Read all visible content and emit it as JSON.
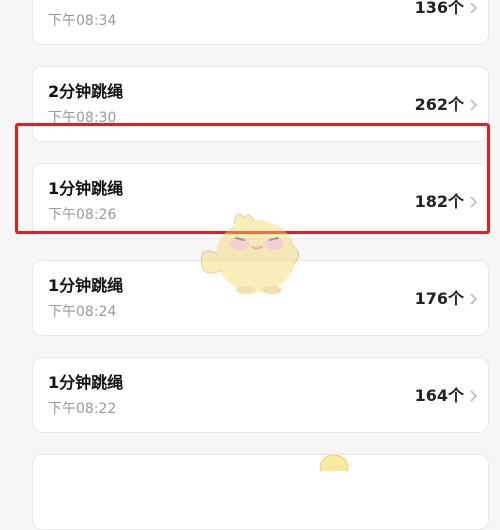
{
  "records": [
    {
      "title": "",
      "time": "下午08:34",
      "count": "136个"
    },
    {
      "title": "2分钟跳绳",
      "time": "下午08:30",
      "count": "262个"
    },
    {
      "title": "1分钟跳绳",
      "time": "下午08:26",
      "count": "182个"
    },
    {
      "title": "1分钟跳绳",
      "time": "下午08:24",
      "count": "176个"
    },
    {
      "title": "1分钟跳绳",
      "time": "下午08:22",
      "count": "164个"
    },
    {
      "title": "",
      "time": "",
      "count": ""
    }
  ],
  "colors": {
    "accent": "#f06a36",
    "highlight": "#e02020",
    "mascot": "#f2d96b"
  },
  "icons": {
    "chevron": "chevron-right-icon",
    "mascot": "chick-mascot-icon"
  }
}
